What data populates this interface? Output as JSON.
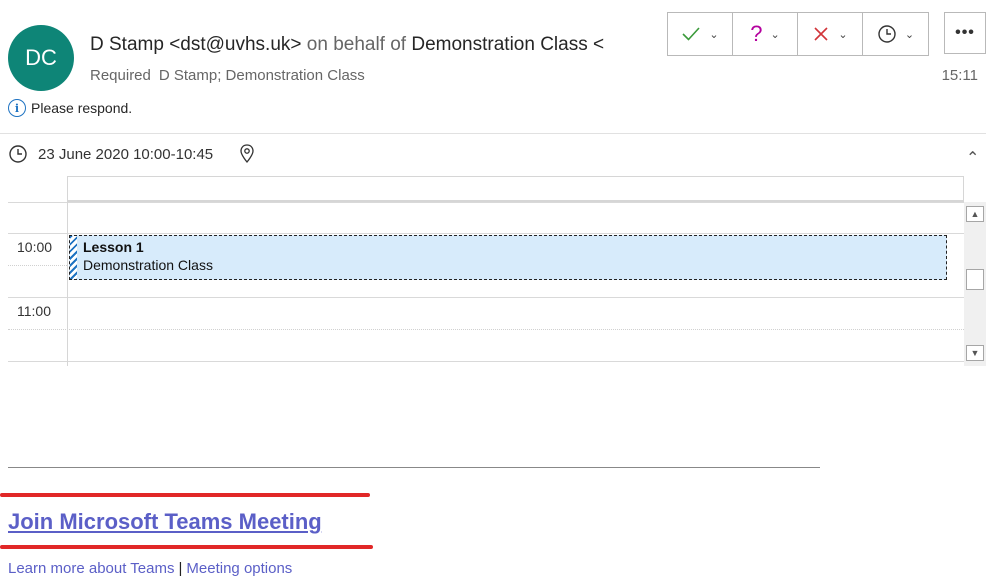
{
  "header": {
    "avatar_initials": "DC",
    "sender_name": "D Stamp <dst@uvhs.uk>",
    "on_behalf_text": "on behalf of",
    "behalf_name": "Demonstration Class <",
    "required_label": "Required",
    "attendees": "D Stamp; Demonstration Class",
    "time": "15:11",
    "respond_text": "Please respond."
  },
  "response_buttons": [
    {
      "name": "accept",
      "icon": "check-icon",
      "color": "#3a9a3a"
    },
    {
      "name": "tentative",
      "icon": "question-icon",
      "color": "#b4009e"
    },
    {
      "name": "decline",
      "icon": "x-icon",
      "color": "#d13438"
    },
    {
      "name": "propose-time",
      "icon": "clock-icon",
      "color": "#333333"
    }
  ],
  "more_label": "•••",
  "meeting": {
    "datetime": "23 June 2020 10:00-10:45"
  },
  "calendar": {
    "time_labels": [
      "10:00",
      "11:00"
    ],
    "appointment": {
      "title": "Lesson 1",
      "subtitle": "Demonstration Class"
    }
  },
  "teams": {
    "join_label": "Join Microsoft Teams Meeting",
    "learn_more": "Learn more about Teams",
    "separator": "|",
    "options": "Meeting options"
  }
}
